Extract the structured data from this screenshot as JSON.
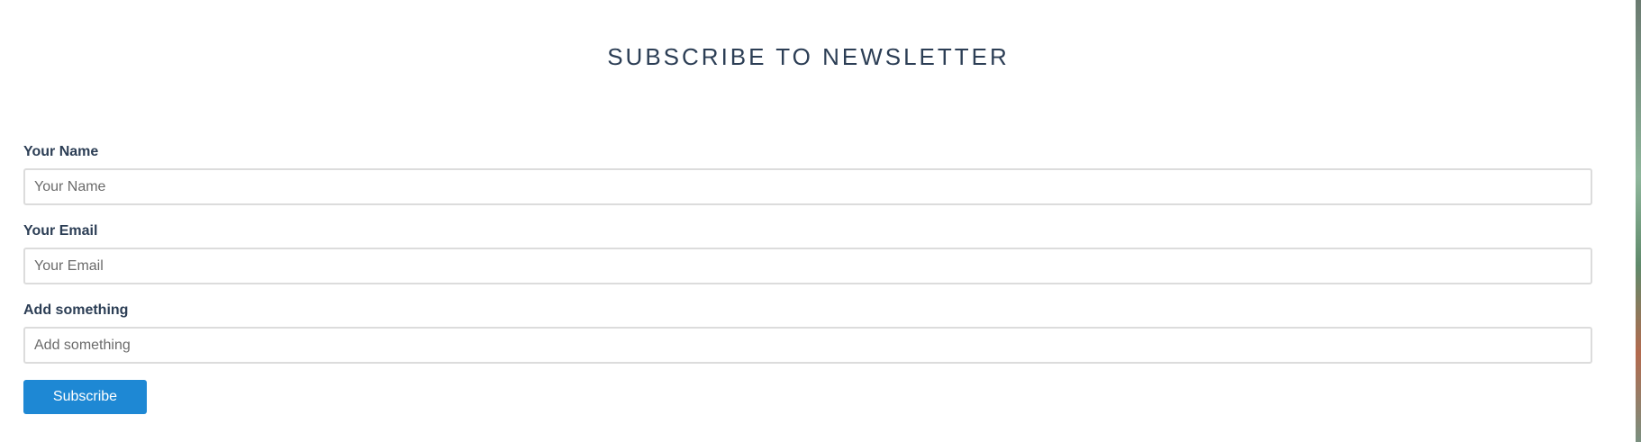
{
  "header": {
    "title": "SUBSCRIBE TO NEWSLETTER"
  },
  "form": {
    "name": {
      "label": "Your Name",
      "placeholder": "Your Name",
      "value": ""
    },
    "email": {
      "label": "Your Email",
      "placeholder": "Your Email",
      "value": ""
    },
    "message": {
      "label": "Add something",
      "placeholder": "Add something",
      "value": ""
    },
    "submit_label": "Subscribe"
  },
  "colors": {
    "text": "#2c3e55",
    "button": "#1e88d4",
    "input_border": "#dcdcdc"
  }
}
